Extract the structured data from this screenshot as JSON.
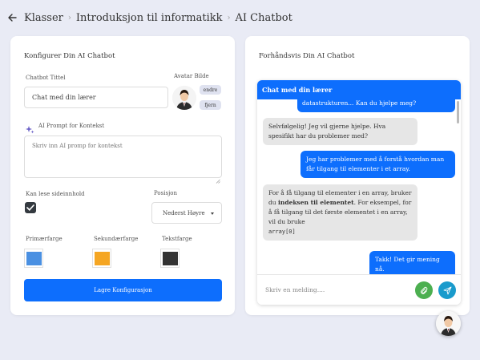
{
  "breadcrumb": {
    "items": [
      "Klasser",
      "Introduksjon til informatikk",
      "AI Chatbot"
    ]
  },
  "config": {
    "title": "Konfigurer Din AI Chatbot",
    "chatbot_title_label": "Chatbot Tittel",
    "chatbot_title_value": "Chat med din lærer",
    "avatar_label": "Avatar Bilde",
    "change_label": "endre",
    "remove_label": "fjern",
    "prompt_label": "AI Prompt for Kontekst",
    "prompt_placeholder": "Skriv inn AI promp for kontekst",
    "read_page_label": "Kan lese sideinnhold",
    "read_page_checked": true,
    "position_label": "Posisjon",
    "position_value": "Nederst Høyre",
    "primary_label": "Primærfarge",
    "secondary_label": "Sekundærfarge",
    "text_color_label": "Tekstfarge",
    "colors": {
      "primary": "#4a90e2",
      "secondary": "#f5a623",
      "text": "#333333"
    },
    "save_label": "Lagre Konfigurasjon"
  },
  "preview": {
    "title": "Forhåndsvis Din AI Chatbot",
    "chat_header": "Chat med din lærer",
    "messages": [
      {
        "from": "user",
        "text": "datastrukturen... Kan du hjelpe meg?"
      },
      {
        "from": "bot",
        "text": "Selvfølgelig! Jeg vil gjerne hjelpe. Hva spesifikt har du problemer med?"
      },
      {
        "from": "user",
        "text": "Jeg har problemer med å forstå hvordan man får tilgang til elementer i et array."
      },
      {
        "from": "bot",
        "text_before": "For å få tilgang til elementer i en array, bruker du",
        "text_bold": "indeksen til elementet",
        "text_after": ". For eksempel, for å få tilgang til det første elementet i en array, vil du bruke",
        "code": "array[0]"
      },
      {
        "from": "user",
        "text": "Takk! Det gir mening nå."
      }
    ],
    "input_placeholder": "Skriv en melding....",
    "attach_color": "#4caf50",
    "send_color": "#1a9bcc"
  }
}
